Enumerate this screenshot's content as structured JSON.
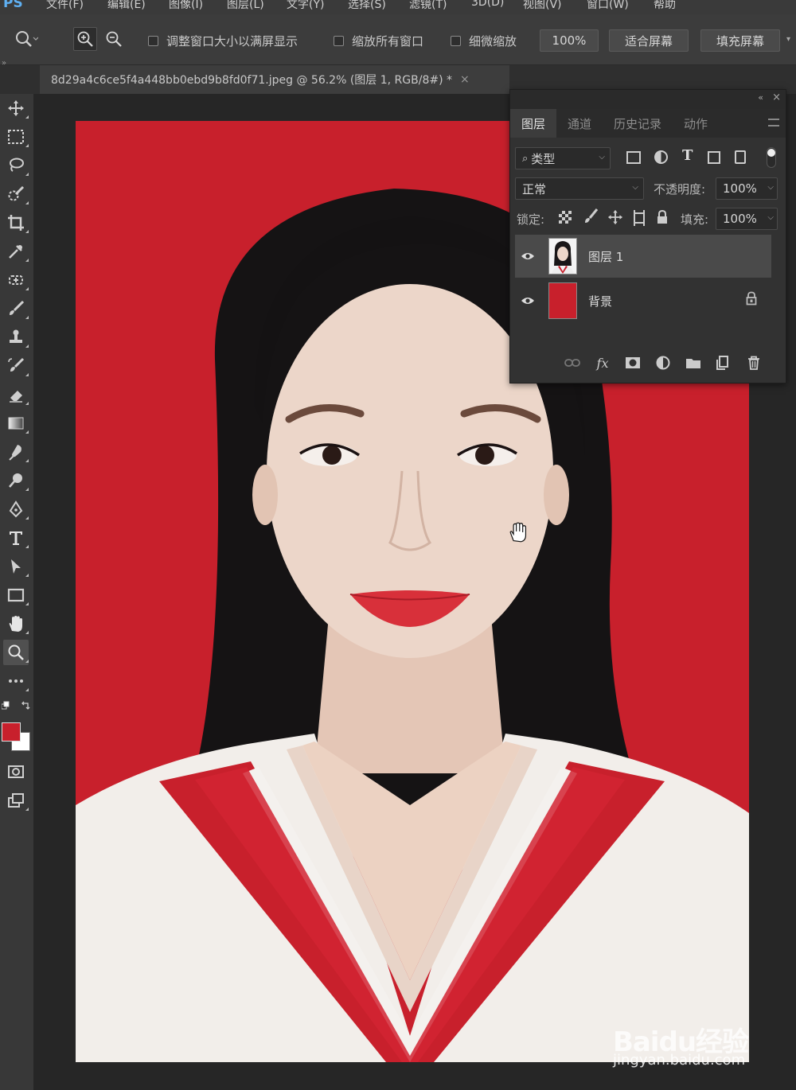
{
  "app": {
    "logo": "PS"
  },
  "menu": [
    "文件(F)",
    "编辑(E)",
    "图像(I)",
    "图层(L)",
    "文字(Y)",
    "选择(S)",
    "滤镜(T)",
    "3D(D)",
    "视图(V)",
    "窗口(W)",
    "帮助"
  ],
  "options": {
    "resize_windows": "调整窗口大小以满屏显示",
    "zoom_all_windows": "缩放所有窗口",
    "scrubby_zoom": "细微缩放",
    "zoom_value": "100%",
    "fit_screen": "适合屏幕",
    "fill_screen": "填充屏幕"
  },
  "document": {
    "tab_title": "8d29a4c6ce5f4a448bb0ebd9b8fd0f71.jpeg @ 56.2% (图层 1, RGB/8#) *",
    "close": "×"
  },
  "colors": {
    "foreground": "#c8202c",
    "background": "#ffffff",
    "canvas_bg": "#c8202c"
  },
  "layers_panel": {
    "tabs": [
      "图层",
      "通道",
      "历史记录",
      "动作"
    ],
    "filter_kind": "类型",
    "blend_mode": "正常",
    "opacity_label": "不透明度:",
    "opacity_value": "100%",
    "lock_label": "锁定:",
    "fill_label": "填充:",
    "fill_value": "100%",
    "layers": [
      {
        "name": "图层 1",
        "selected": true
      },
      {
        "name": "背景",
        "locked": true
      }
    ]
  },
  "watermark": {
    "brand": "Baidu经验",
    "url": "jingyan.baidu.com"
  }
}
